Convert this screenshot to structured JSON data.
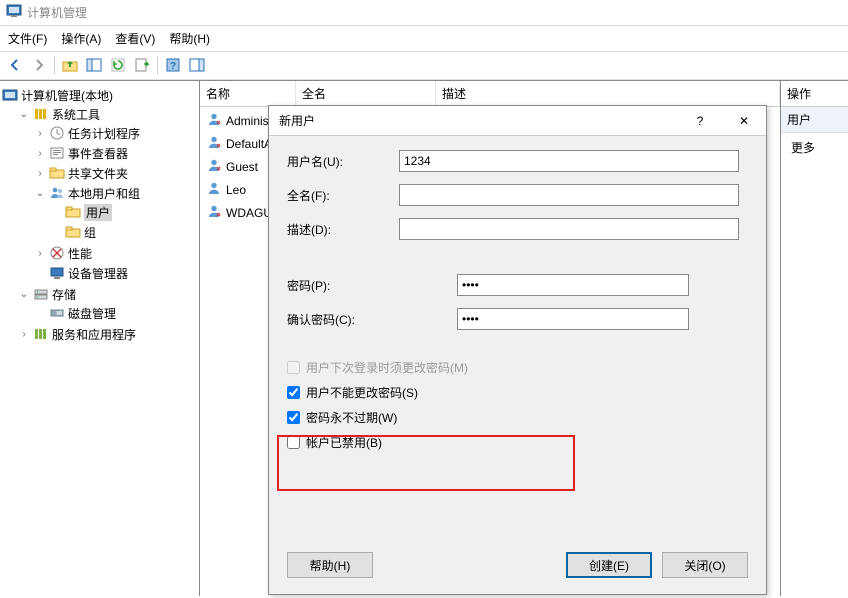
{
  "window": {
    "title": "计算机管理"
  },
  "menu": {
    "file": "文件(F)",
    "action": "操作(A)",
    "view": "查看(V)",
    "help": "帮助(H)"
  },
  "tree": {
    "root": "计算机管理(本地)",
    "system_tools": "系统工具",
    "task_scheduler": "任务计划程序",
    "event_viewer": "事件查看器",
    "shared_folders": "共享文件夹",
    "local_users_groups": "本地用户和组",
    "users": "用户",
    "groups": "组",
    "performance": "性能",
    "device_manager": "设备管理器",
    "storage": "存储",
    "disk_management": "磁盘管理",
    "services_apps": "服务和应用程序"
  },
  "list": {
    "headers": {
      "name": "名称",
      "full": "全名",
      "desc": "描述"
    },
    "rows": [
      {
        "name": "Administr"
      },
      {
        "name": "DefaultA"
      },
      {
        "name": "Guest"
      },
      {
        "name": "Leo"
      },
      {
        "name": "WDAGUt"
      }
    ]
  },
  "actions": {
    "header": "操作",
    "sub": "用户",
    "more": "更多"
  },
  "dialog": {
    "title": "新用户",
    "username_label": "用户名(U):",
    "username_value": "1234",
    "fullname_label": "全名(F):",
    "fullname_value": "",
    "description_label": "描述(D):",
    "description_value": "",
    "password_label": "密码(P):",
    "password_value": "••••",
    "confirm_label": "确认密码(C):",
    "confirm_value": "••••",
    "chk_must_change": "用户下次登录时须更改密码(M)",
    "chk_cannot_change": "用户不能更改密码(S)",
    "chk_never_expires": "密码永不过期(W)",
    "chk_disabled": "帐户已禁用(B)",
    "btn_help": "帮助(H)",
    "btn_create": "创建(E)",
    "btn_close": "关闭(O)"
  }
}
